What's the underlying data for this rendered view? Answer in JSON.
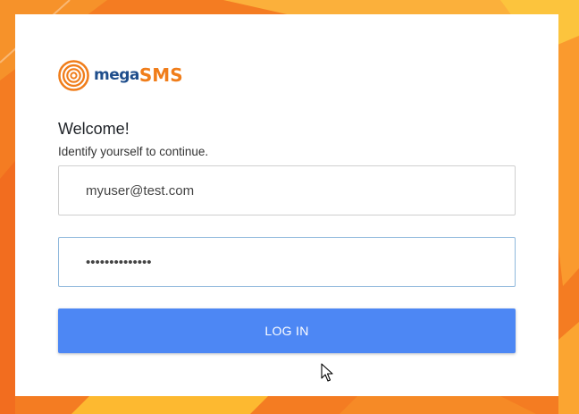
{
  "brand": {
    "name_part1": "mega",
    "name_part2": "SMS",
    "icon": "concentric-rings-logo-icon",
    "color_primary": "#1f4e8c",
    "color_accent": "#f07d1a"
  },
  "welcome": {
    "title": "Welcome!",
    "subtitle": "Identify yourself to continue."
  },
  "form": {
    "email_value": "myuser@test.com",
    "password_value": "••••••••••••••",
    "login_label": "LOG IN"
  },
  "colors": {
    "background": "#f47c22",
    "button": "#4d87f4",
    "focused_border": "#8fb8dc"
  },
  "cursor": {
    "icon": "arrow-pointer-icon"
  }
}
